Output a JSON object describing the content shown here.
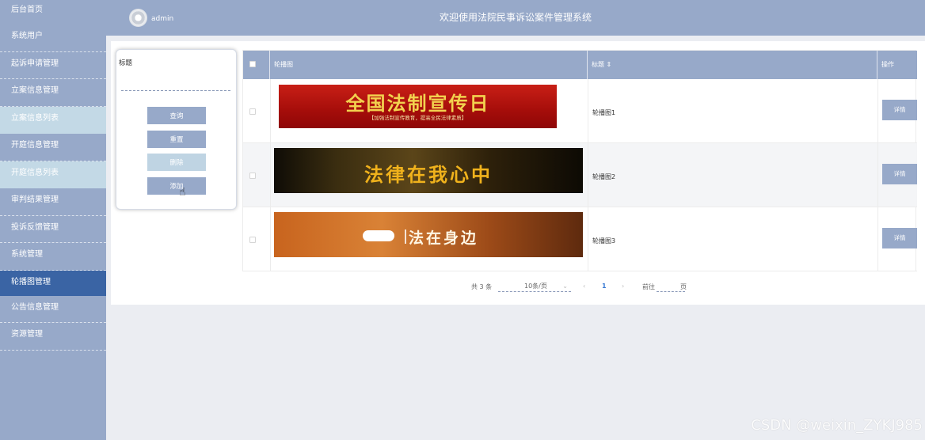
{
  "sidebar": {
    "items": [
      {
        "label": "后台首页"
      },
      {
        "label": "系统用户"
      },
      {
        "label": "起诉申请管理"
      },
      {
        "label": "立案信息管理"
      },
      {
        "label": "立案信息列表"
      },
      {
        "label": "开庭信息管理"
      },
      {
        "label": "开庭信息列表"
      },
      {
        "label": "审判结果管理"
      },
      {
        "label": "投诉反馈管理"
      },
      {
        "label": "系统管理"
      },
      {
        "label": "轮播图管理"
      },
      {
        "label": "公告信息管理"
      },
      {
        "label": "资源管理"
      }
    ]
  },
  "header": {
    "user": "admin",
    "title": "欢迎使用法院民事诉讼案件管理系统"
  },
  "search": {
    "label": "标题",
    "placeholder": "",
    "query_label": "查询",
    "reset_label": "重置",
    "delete_label": "删除",
    "add_label": "添加"
  },
  "table": {
    "columns": [
      "轮播图",
      "标题 ⇕",
      "操作"
    ],
    "rows": [
      {
        "title": "轮播图1",
        "banner_main": "全国法制宣传日",
        "banner_sub": "【加强法制宣传教育，提高全民法律素质】",
        "action": "详情"
      },
      {
        "title": "轮播图2",
        "banner_main": "法律在我心中",
        "action": "详情"
      },
      {
        "title": "轮播图3",
        "banner_main": "法在身边",
        "action": "详情"
      }
    ]
  },
  "pagination": {
    "total": "共 3 条",
    "page_size": "10条/页",
    "current": "1",
    "goto_label": "前往",
    "unit": "页"
  },
  "watermark": "CSDN @weixin_ZYKJ985",
  "colors": {
    "primary": "#97a9c9",
    "active": "#3a64a4",
    "light": "#c3d9e6"
  }
}
